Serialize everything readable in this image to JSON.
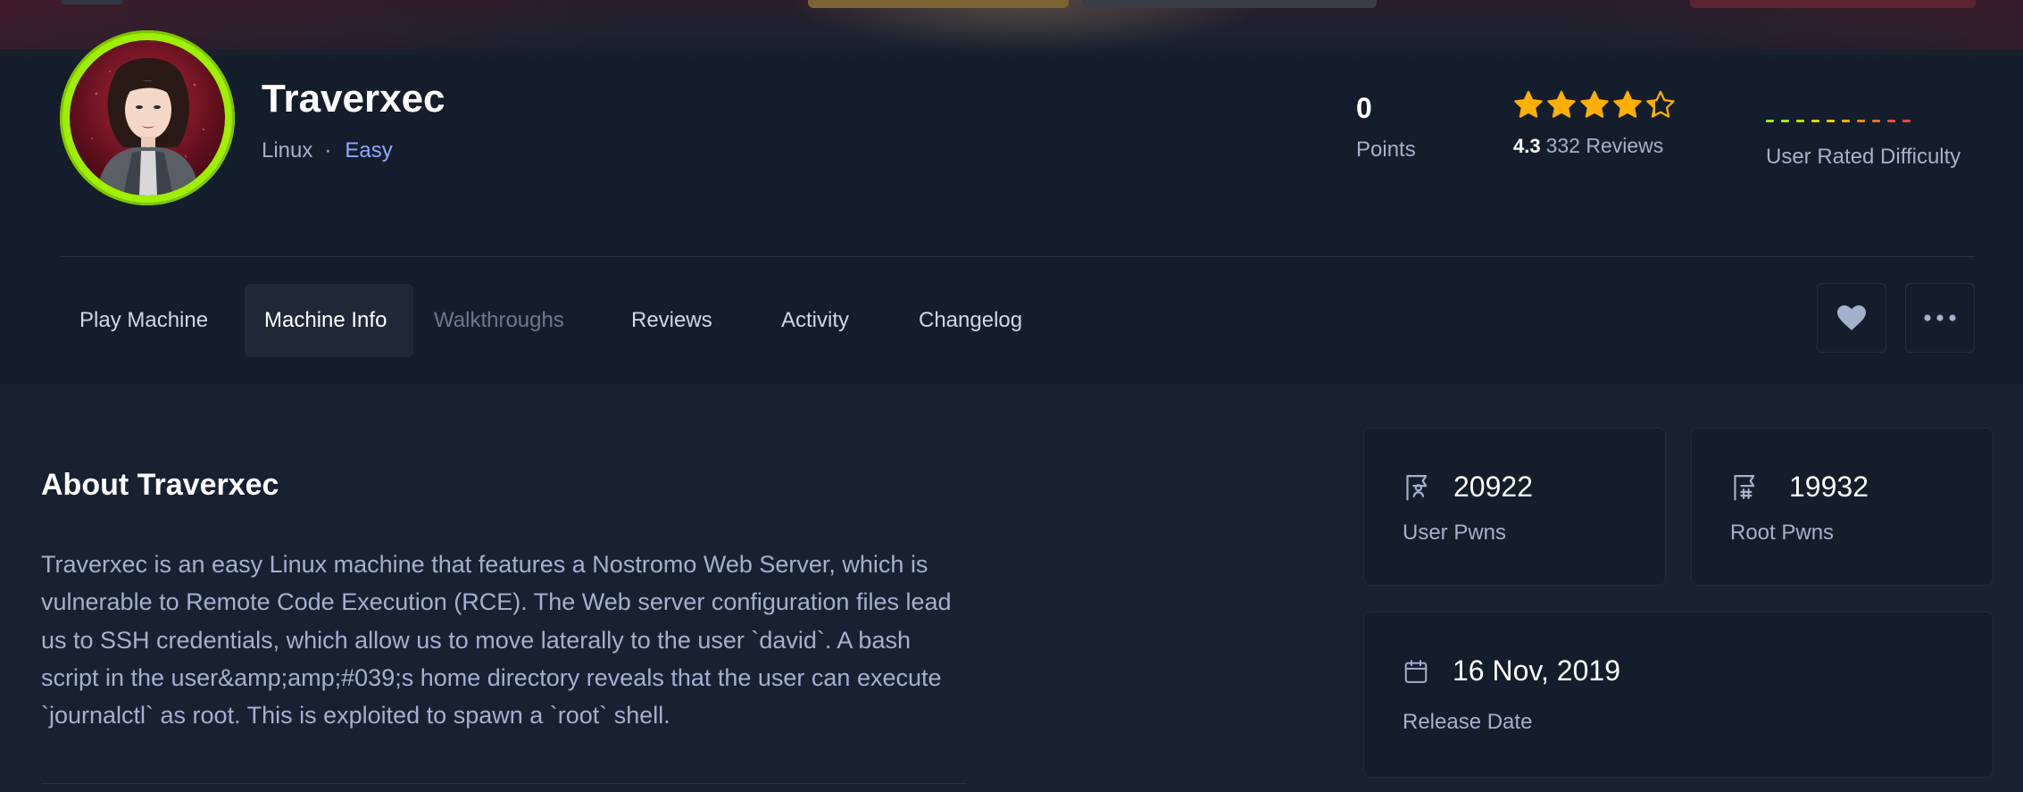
{
  "machine": {
    "name": "Traverxec",
    "os": "Linux",
    "separator": "·",
    "difficulty": "Easy"
  },
  "stats": {
    "points_value": "0",
    "points_label": "Points",
    "rating_value": "4.3",
    "rating_stars": 4.3,
    "reviews_label": "332 Reviews",
    "difficulty_label": "User Rated Difficulty"
  },
  "tabs": [
    {
      "label": "Play Machine"
    },
    {
      "label": "Machine Info"
    },
    {
      "label": "Walkthroughs"
    },
    {
      "label": "Reviews"
    },
    {
      "label": "Activity"
    },
    {
      "label": "Changelog"
    }
  ],
  "about": {
    "title": "About Traverxec",
    "text": "Traverxec is an easy Linux machine that features a Nostromo Web Server, which is vulnerable to Remote Code Execution (RCE). The Web server configuration files lead us to SSH credentials, which allow us to move laterally to the user `david`. A bash script in the user&amp;amp;#039;s home directory reveals that the user can execute `journalctl` as root. This is exploited to spawn a `root` shell."
  },
  "cards": {
    "user_pwns_value": "20922",
    "user_pwns_label": "User Pwns",
    "root_pwns_value": "19932",
    "root_pwns_label": "Root Pwns",
    "release_value": "16 Nov, 2019",
    "release_label": "Release Date"
  },
  "colors": {
    "accent_green": "#9fef00",
    "star": "#ffaf00",
    "difficulty_link": "#8fa8ff"
  }
}
